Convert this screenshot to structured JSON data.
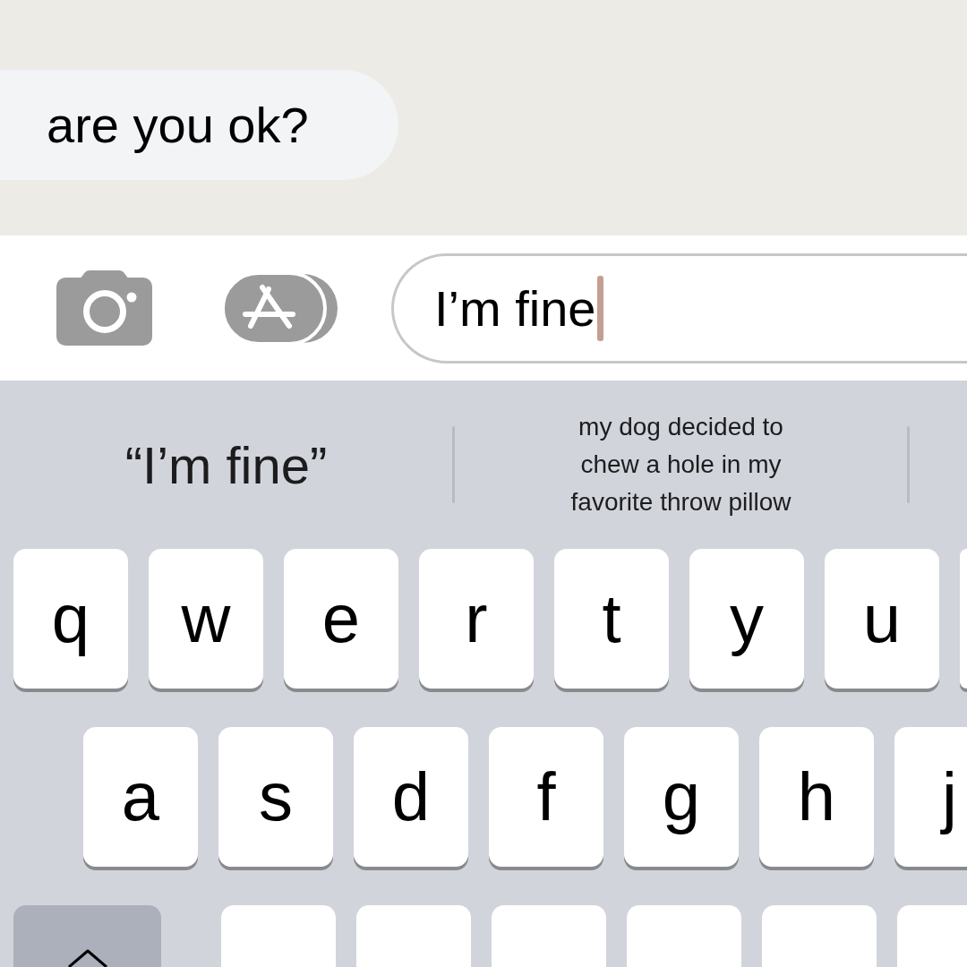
{
  "thread": {
    "messages": [
      {
        "kind": "received",
        "text": "are you ok?"
      }
    ]
  },
  "compose_bar": {
    "message_field": {
      "value": "I’m fine",
      "focused": true
    }
  },
  "keyboard": {
    "suggestions": [
      {
        "kind": "typed",
        "text": "“I’m fine”"
      },
      {
        "kind": "prediction",
        "text": "my dog decided to chew a hole in my favorite throw pillow"
      }
    ],
    "rows": [
      {
        "keys": [
          {
            "kind": "letter",
            "label": "q"
          },
          {
            "kind": "letter",
            "label": "w"
          },
          {
            "kind": "letter",
            "label": "e"
          },
          {
            "kind": "letter",
            "label": "r"
          },
          {
            "kind": "letter",
            "label": "t"
          },
          {
            "kind": "letter",
            "label": "y"
          },
          {
            "kind": "letter",
            "label": "u"
          },
          {
            "kind": "blank"
          }
        ]
      },
      {
        "keys": [
          {
            "kind": "letter",
            "label": "a"
          },
          {
            "kind": "letter",
            "label": "s"
          },
          {
            "kind": "letter",
            "label": "d"
          },
          {
            "kind": "letter",
            "label": "f"
          },
          {
            "kind": "letter",
            "label": "g"
          },
          {
            "kind": "letter",
            "label": "h"
          },
          {
            "kind": "letter",
            "label": "j"
          }
        ]
      },
      {
        "keys": [
          {
            "kind": "shift",
            "on": false
          },
          {
            "kind": "blank"
          },
          {
            "kind": "blank"
          },
          {
            "kind": "blank"
          },
          {
            "kind": "blank"
          },
          {
            "kind": "blank"
          },
          {
            "kind": "blank"
          }
        ]
      }
    ]
  }
}
